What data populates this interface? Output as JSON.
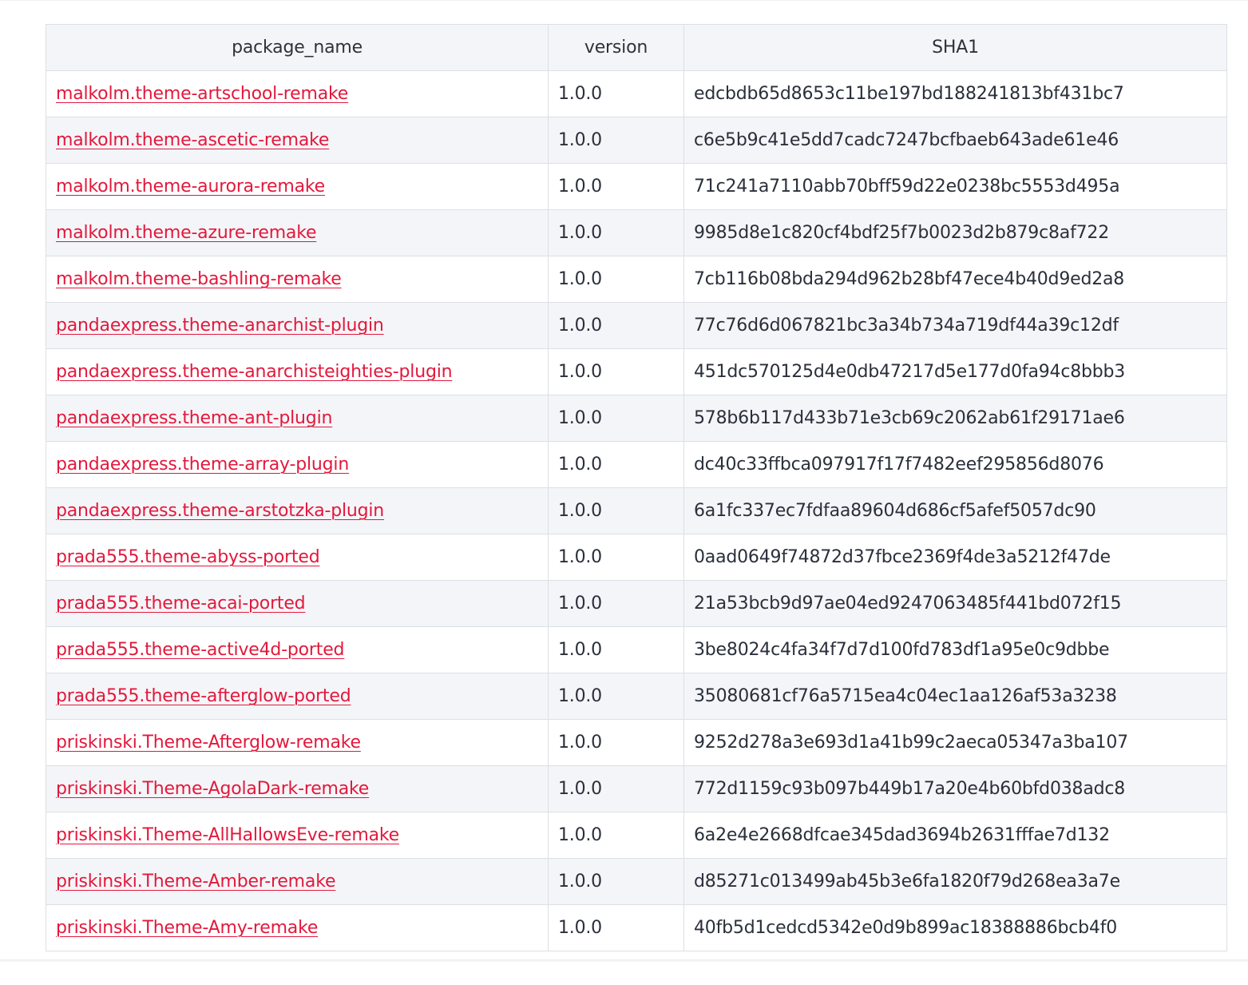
{
  "table": {
    "headers": [
      "package_name",
      "version",
      "SHA1"
    ],
    "rows": [
      {
        "package_name": "malkolm.theme-artschool-remake",
        "version": "1.0.0",
        "sha1": "edcbdb65d8653c11be197bd188241813bf431bc7"
      },
      {
        "package_name": "malkolm.theme-ascetic-remake",
        "version": "1.0.0",
        "sha1": "c6e5b9c41e5dd7cadc7247bcfbaeb643ade61e46"
      },
      {
        "package_name": "malkolm.theme-aurora-remake",
        "version": "1.0.0",
        "sha1": "71c241a7110abb70bff59d22e0238bc5553d495a"
      },
      {
        "package_name": "malkolm.theme-azure-remake",
        "version": "1.0.0",
        "sha1": "9985d8e1c820cf4bdf25f7b0023d2b879c8af722"
      },
      {
        "package_name": "malkolm.theme-bashling-remake",
        "version": "1.0.0",
        "sha1": "7cb116b08bda294d962b28bf47ece4b40d9ed2a8"
      },
      {
        "package_name": "pandaexpress.theme-anarchist-plugin",
        "version": "1.0.0",
        "sha1": "77c76d6d067821bc3a34b734a719df44a39c12df"
      },
      {
        "package_name": "pandaexpress.theme-anarchisteighties-plugin",
        "version": "1.0.0",
        "sha1": "451dc570125d4e0db47217d5e177d0fa94c8bbb3"
      },
      {
        "package_name": "pandaexpress.theme-ant-plugin",
        "version": "1.0.0",
        "sha1": "578b6b117d433b71e3cb69c2062ab61f29171ae6"
      },
      {
        "package_name": "pandaexpress.theme-array-plugin",
        "version": "1.0.0",
        "sha1": "dc40c33ffbca097917f17f7482eef295856d8076"
      },
      {
        "package_name": "pandaexpress.theme-arstotzka-plugin",
        "version": "1.0.0",
        "sha1": "6a1fc337ec7fdfaa89604d686cf5afef5057dc90"
      },
      {
        "package_name": "prada555.theme-abyss-ported",
        "version": "1.0.0",
        "sha1": "0aad0649f74872d37fbce2369f4de3a5212f47de"
      },
      {
        "package_name": "prada555.theme-acai-ported",
        "version": "1.0.0",
        "sha1": "21a53bcb9d97ae04ed9247063485f441bd072f15"
      },
      {
        "package_name": "prada555.theme-active4d-ported",
        "version": "1.0.0",
        "sha1": "3be8024c4fa34f7d7d100fd783df1a95e0c9dbbe"
      },
      {
        "package_name": "prada555.theme-afterglow-ported",
        "version": "1.0.0",
        "sha1": "35080681cf76a5715ea4c04ec1aa126af53a3238"
      },
      {
        "package_name": "priskinski.Theme-Afterglow-remake",
        "version": "1.0.0",
        "sha1": "9252d278a3e693d1a41b99c2aeca05347a3ba107"
      },
      {
        "package_name": "priskinski.Theme-AgolaDark-remake",
        "version": "1.0.0",
        "sha1": "772d1159c93b097b449b17a20e4b60bfd038adc8"
      },
      {
        "package_name": "priskinski.Theme-AllHallowsEve-remake",
        "version": "1.0.0",
        "sha1": "6a2e4e2668dfcae345dad3694b2631fffae7d132"
      },
      {
        "package_name": "priskinski.Theme-Amber-remake",
        "version": "1.0.0",
        "sha1": "d85271c013499ab45b3e6fa1820f79d268ea3a7e"
      },
      {
        "package_name": "priskinski.Theme-Amy-remake",
        "version": "1.0.0",
        "sha1": "40fb5d1cedcd5342e0d9b899ac18388886bcb4f0"
      }
    ]
  },
  "colors": {
    "link": "#e3183c",
    "header_bg": "#f4f5f8",
    "stripe_bg": "#f4f5f8",
    "border": "#dcdfe4",
    "text": "#2a2f3a"
  }
}
